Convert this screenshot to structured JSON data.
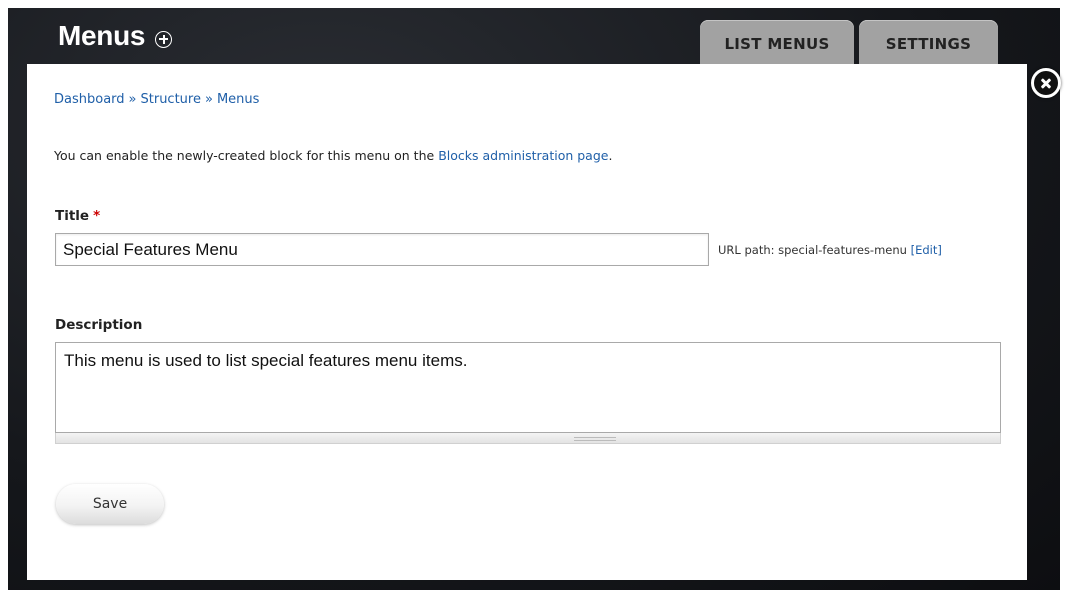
{
  "header": {
    "title": "Menus",
    "add_icon": "circle-plus-icon",
    "tabs": [
      {
        "label": "LIST MENUS"
      },
      {
        "label": "SETTINGS"
      }
    ],
    "close_icon": "close-icon"
  },
  "breadcrumb": {
    "items": [
      "Dashboard",
      "Structure",
      "Menus"
    ],
    "separator": "»"
  },
  "message": {
    "prefix": "You can enable the newly-created block for this menu on the",
    "link": "Blocks administration page",
    "suffix": "."
  },
  "form": {
    "title_label": "Title",
    "required_mark": "*",
    "title_value": "Special Features Menu",
    "url_path_label": "URL path: special-features-menu",
    "url_edit_link": "[Edit]",
    "description_label": "Description",
    "description_value": "This menu is used to list special features menu items.",
    "save_label": "Save"
  },
  "colors": {
    "link": "#1f5fa8",
    "tab_bg": "#a2a2a2",
    "required": "#cc0000"
  }
}
